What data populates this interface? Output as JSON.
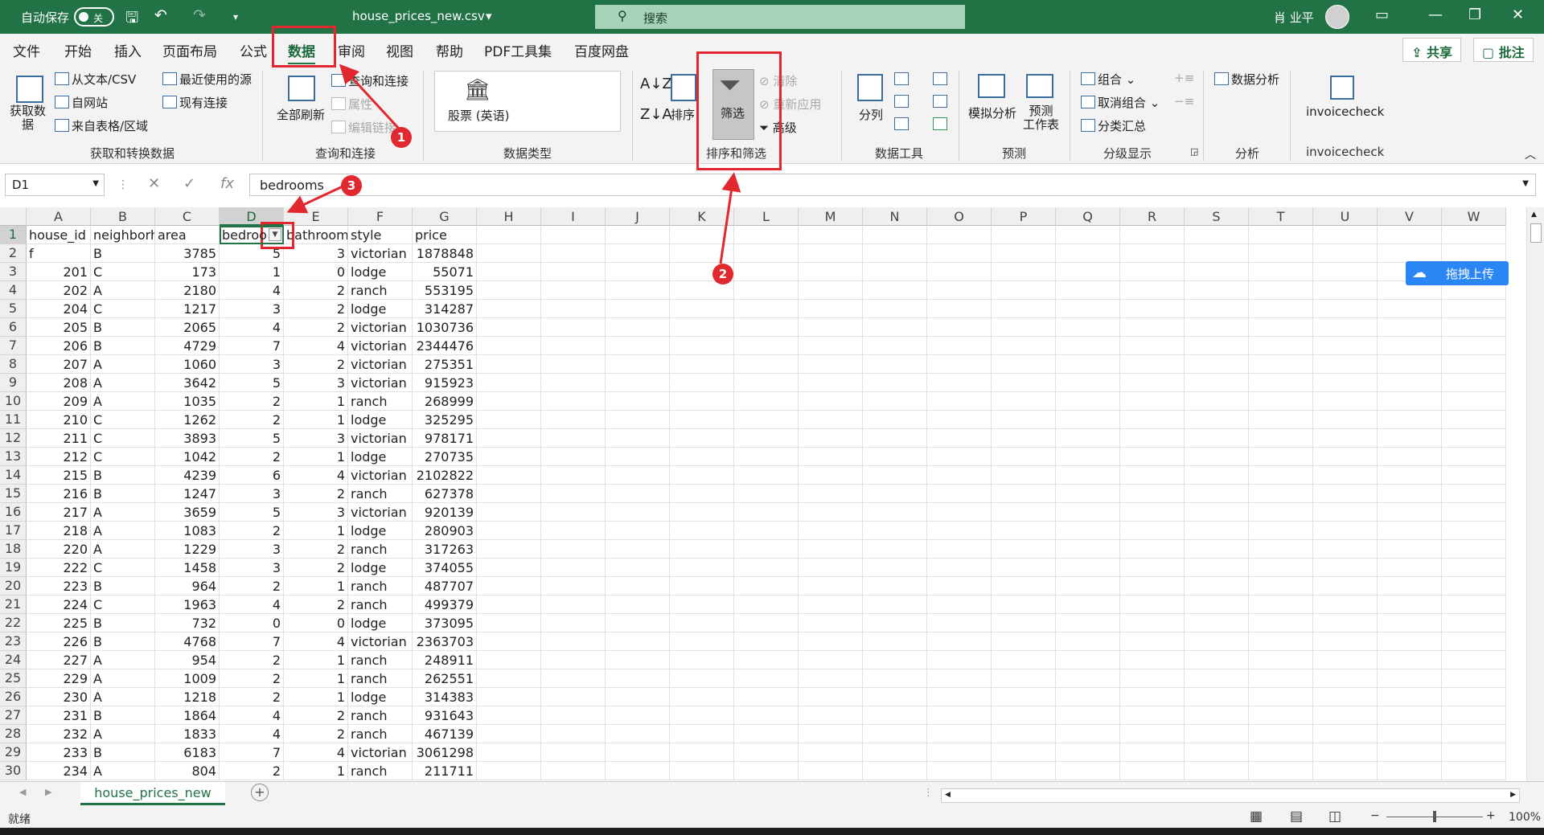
{
  "titlebar": {
    "autosave_label": "自动保存",
    "autosave_state": "关",
    "filename": "house_prices_new.csv",
    "filename_caret": "▾",
    "search_placeholder": "搜索",
    "user_name": "肖 业平"
  },
  "menu": [
    "文件",
    "开始",
    "插入",
    "页面布局",
    "公式",
    "数据",
    "审阅",
    "视图",
    "帮助",
    "PDF工具集",
    "百度网盘"
  ],
  "share_label": "共享",
  "comment_label": "批注",
  "ribbon": {
    "get_data": "获取数\n据",
    "from_text": "从文本/CSV",
    "from_web": "自网站",
    "from_table": "来自表格/区域",
    "recent_sources": "最近使用的源",
    "existing_conn": "现有连接",
    "group_get": "获取和转换数据",
    "refresh_all": "全部刷新",
    "queries_conn": "查询和连接",
    "properties": "属性",
    "edit_links": "编辑链接",
    "group_query": "查询和连接",
    "stocks": "股票 (英语)",
    "group_types": "数据类型",
    "sort": "排序",
    "filter": "筛选",
    "clear": "清除",
    "reapply": "重新应用",
    "advanced": "高级",
    "group_sort": "排序和筛选",
    "text_to_cols": "分列",
    "group_tools": "数据工具",
    "whatif": "模拟分析",
    "forecast": "预测\n工作表",
    "group_forecast": "预测",
    "group_btn": "组合",
    "ungroup_btn": "取消组合",
    "subtotal": "分类汇总",
    "group_outline": "分级显示",
    "data_analysis": "数据分析",
    "group_analysis": "分析",
    "invoicecheck": "invoicecheck",
    "group_invoice": "invoicecheck"
  },
  "formula": {
    "name_box": "D1",
    "value": "bedrooms"
  },
  "columns": [
    "A",
    "B",
    "C",
    "D",
    "E",
    "F",
    "G",
    "H",
    "I",
    "J",
    "K",
    "L",
    "M",
    "N",
    "O",
    "P",
    "Q",
    "R",
    "S",
    "T",
    "U",
    "V",
    "W"
  ],
  "header_row": [
    "house_id",
    "neighborh",
    "area",
    "bedroo",
    "bathroom",
    "style",
    "price"
  ],
  "rows": [
    [
      "f",
      "B",
      "3785",
      "5",
      "3",
      "victorian",
      "1878848"
    ],
    [
      "201",
      "C",
      "173",
      "1",
      "0",
      "lodge",
      "55071"
    ],
    [
      "202",
      "A",
      "2180",
      "4",
      "2",
      "ranch",
      "553195"
    ],
    [
      "204",
      "C",
      "1217",
      "3",
      "2",
      "lodge",
      "314287"
    ],
    [
      "205",
      "B",
      "2065",
      "4",
      "2",
      "victorian",
      "1030736"
    ],
    [
      "206",
      "B",
      "4729",
      "7",
      "4",
      "victorian",
      "2344476"
    ],
    [
      "207",
      "A",
      "1060",
      "3",
      "2",
      "victorian",
      "275351"
    ],
    [
      "208",
      "A",
      "3642",
      "5",
      "3",
      "victorian",
      "915923"
    ],
    [
      "209",
      "A",
      "1035",
      "2",
      "1",
      "ranch",
      "268999"
    ],
    [
      "210",
      "C",
      "1262",
      "2",
      "1",
      "lodge",
      "325295"
    ],
    [
      "211",
      "C",
      "3893",
      "5",
      "3",
      "victorian",
      "978171"
    ],
    [
      "212",
      "C",
      "1042",
      "2",
      "1",
      "lodge",
      "270735"
    ],
    [
      "215",
      "B",
      "4239",
      "6",
      "4",
      "victorian",
      "2102822"
    ],
    [
      "216",
      "B",
      "1247",
      "3",
      "2",
      "ranch",
      "627378"
    ],
    [
      "217",
      "A",
      "3659",
      "5",
      "3",
      "victorian",
      "920139"
    ],
    [
      "218",
      "A",
      "1083",
      "2",
      "1",
      "lodge",
      "280903"
    ],
    [
      "220",
      "A",
      "1229",
      "3",
      "2",
      "ranch",
      "317263"
    ],
    [
      "222",
      "C",
      "1458",
      "3",
      "2",
      "lodge",
      "374055"
    ],
    [
      "223",
      "B",
      "964",
      "2",
      "1",
      "ranch",
      "487707"
    ],
    [
      "224",
      "C",
      "1963",
      "4",
      "2",
      "ranch",
      "499379"
    ],
    [
      "225",
      "B",
      "732",
      "0",
      "0",
      "lodge",
      "373095"
    ],
    [
      "226",
      "B",
      "4768",
      "7",
      "4",
      "victorian",
      "2363703"
    ],
    [
      "227",
      "A",
      "954",
      "2",
      "1",
      "ranch",
      "248911"
    ],
    [
      "229",
      "A",
      "1009",
      "2",
      "1",
      "ranch",
      "262551"
    ],
    [
      "230",
      "A",
      "1218",
      "2",
      "1",
      "lodge",
      "314383"
    ],
    [
      "231",
      "B",
      "1864",
      "4",
      "2",
      "ranch",
      "931643"
    ],
    [
      "232",
      "A",
      "1833",
      "4",
      "2",
      "ranch",
      "467139"
    ],
    [
      "233",
      "B",
      "6183",
      "7",
      "4",
      "victorian",
      "3061298"
    ],
    [
      "234",
      "A",
      "804",
      "2",
      "1",
      "ranch",
      "211711"
    ]
  ],
  "sheet_tab": "house_prices_new",
  "status": {
    "ready": "就绪",
    "zoom": "100%"
  },
  "baidu_upload": "拖拽上传",
  "annotations": [
    "1",
    "2",
    "3"
  ],
  "colors": {
    "excel_green": "#217346",
    "annotation_red": "#e0282e"
  }
}
